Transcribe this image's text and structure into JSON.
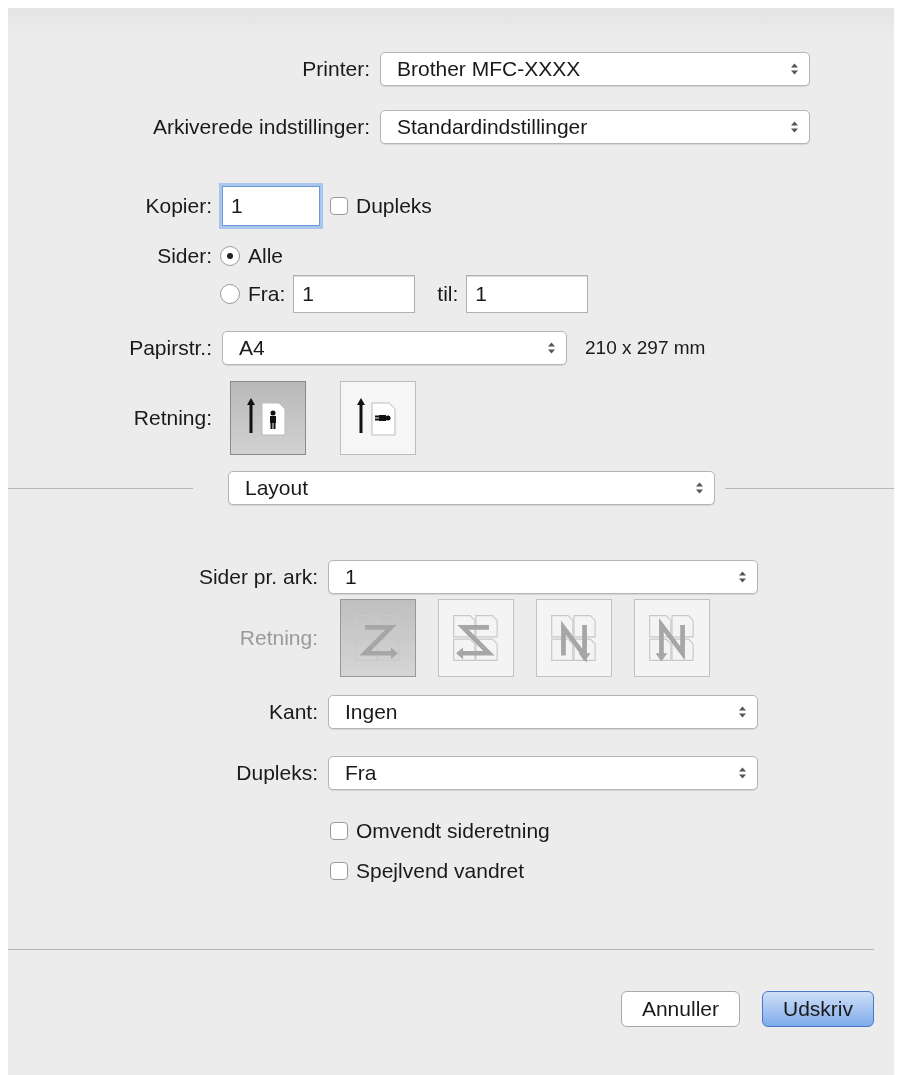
{
  "printer": {
    "label": "Printer:",
    "value": "Brother MFC-XXXX"
  },
  "presets": {
    "label": "Arkiverede indstillinger:",
    "value": "Standardindstillinger"
  },
  "copies": {
    "label": "Kopier:",
    "value": "1",
    "focused": true
  },
  "duplex_option": {
    "label": "Dupleks",
    "checked": false
  },
  "pages": {
    "label": "Sider:",
    "options": [
      {
        "label": "Alle",
        "selected": true
      },
      {
        "label": "Fra:",
        "selected": false
      }
    ],
    "from": "1",
    "to_label": "til:",
    "to": "1"
  },
  "paper_size": {
    "label": "Papirstr.:",
    "value": "A4",
    "dimensions": "210 x 297 mm"
  },
  "orientation": {
    "label": "Retning:",
    "options": [
      {
        "kind": "portrait",
        "selected": true
      },
      {
        "kind": "landscape",
        "selected": false
      }
    ]
  },
  "section_menu": {
    "value": "Layout"
  },
  "layout": {
    "pages_per_sheet": {
      "label": "Sider pr. ark:",
      "value": "1"
    },
    "direction": {
      "label": "Retning:",
      "disabled": true,
      "options": [
        {
          "kind": "z",
          "selected": true
        },
        {
          "kind": "s",
          "selected": false
        },
        {
          "kind": "n-reverse",
          "selected": false
        },
        {
          "kind": "n",
          "selected": false
        }
      ]
    },
    "border": {
      "label": "Kant:",
      "value": "Ingen"
    },
    "duplex": {
      "label": "Dupleks:",
      "value": "Fra"
    },
    "checkboxes": [
      {
        "label": "Omvendt sideretning",
        "checked": false
      },
      {
        "label": "Spejlvend vandret",
        "checked": false
      }
    ]
  },
  "buttons": [
    {
      "label": "Annuller",
      "kind": "secondary"
    },
    {
      "label": "Udskriv",
      "kind": "default"
    }
  ]
}
